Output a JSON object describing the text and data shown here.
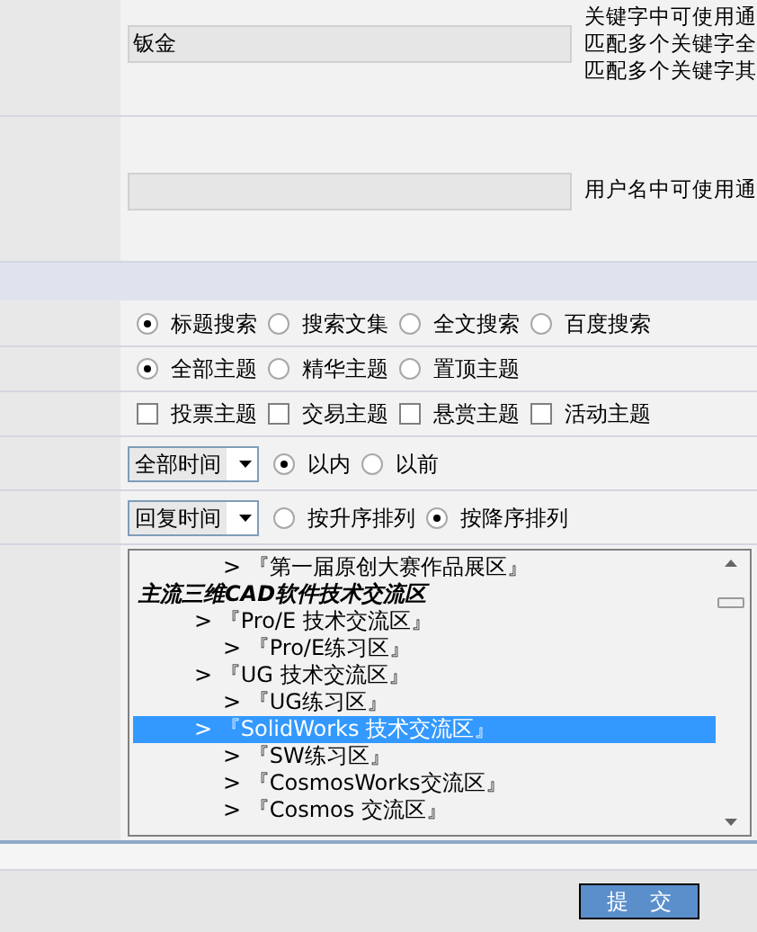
{
  "keyword_row": {
    "value": "钣金",
    "hints": [
      "关键字中可使用通",
      "匹配多个关键字全",
      "匹配多个关键字其"
    ]
  },
  "username_row": {
    "hint": "用户名中可使用通"
  },
  "search_type": [
    {
      "label": "标题搜索",
      "selected": true
    },
    {
      "label": "搜索文集",
      "selected": false
    },
    {
      "label": "全文搜索",
      "selected": false
    },
    {
      "label": "百度搜索",
      "selected": false
    }
  ],
  "thread_scope": [
    {
      "label": "全部主题",
      "selected": true
    },
    {
      "label": "精华主题",
      "selected": false
    },
    {
      "label": "置顶主题",
      "selected": false
    }
  ],
  "thread_types": [
    {
      "label": "投票主题",
      "checked": false
    },
    {
      "label": "交易主题",
      "checked": false
    },
    {
      "label": "悬赏主题",
      "checked": false
    },
    {
      "label": "活动主题",
      "checked": false
    }
  ],
  "time_filter": {
    "select": "全部时间",
    "options": [
      {
        "label": "以内",
        "selected": true
      },
      {
        "label": "以前",
        "selected": false
      }
    ]
  },
  "sort": {
    "select": "回复时间",
    "options": [
      {
        "label": "按升序排列",
        "selected": false
      },
      {
        "label": "按降序排列",
        "selected": true
      }
    ]
  },
  "forum_list": [
    {
      "kind": "subforum",
      "label": "> 『第一届原创大赛作品展区』",
      "selected": false
    },
    {
      "kind": "group",
      "label": "主流三维CAD软件技术交流区",
      "selected": false,
      "children": [
        {
          "kind": "forum",
          "label": "> 『Pro/E 技术交流区』",
          "selected": false,
          "children": [
            {
              "kind": "subforum",
              "label": "> 『Pro/E练习区』",
              "selected": false
            }
          ]
        },
        {
          "kind": "forum",
          "label": "> 『UG 技术交流区』",
          "selected": false,
          "children": [
            {
              "kind": "subforum",
              "label": "> 『UG练习区』",
              "selected": false
            }
          ]
        },
        {
          "kind": "forum",
          "label": "> 『SolidWorks 技术交流区』",
          "selected": true,
          "children": [
            {
              "kind": "subforum",
              "label": "> 『SW练习区』",
              "selected": false
            },
            {
              "kind": "subforum",
              "label": "> 『CosmosWorks交流区』",
              "selected": false
            },
            {
              "kind": "subforum",
              "label": "> 『Cosmos 交流区』",
              "selected": false
            }
          ]
        }
      ]
    }
  ],
  "submit_button": "提　交"
}
